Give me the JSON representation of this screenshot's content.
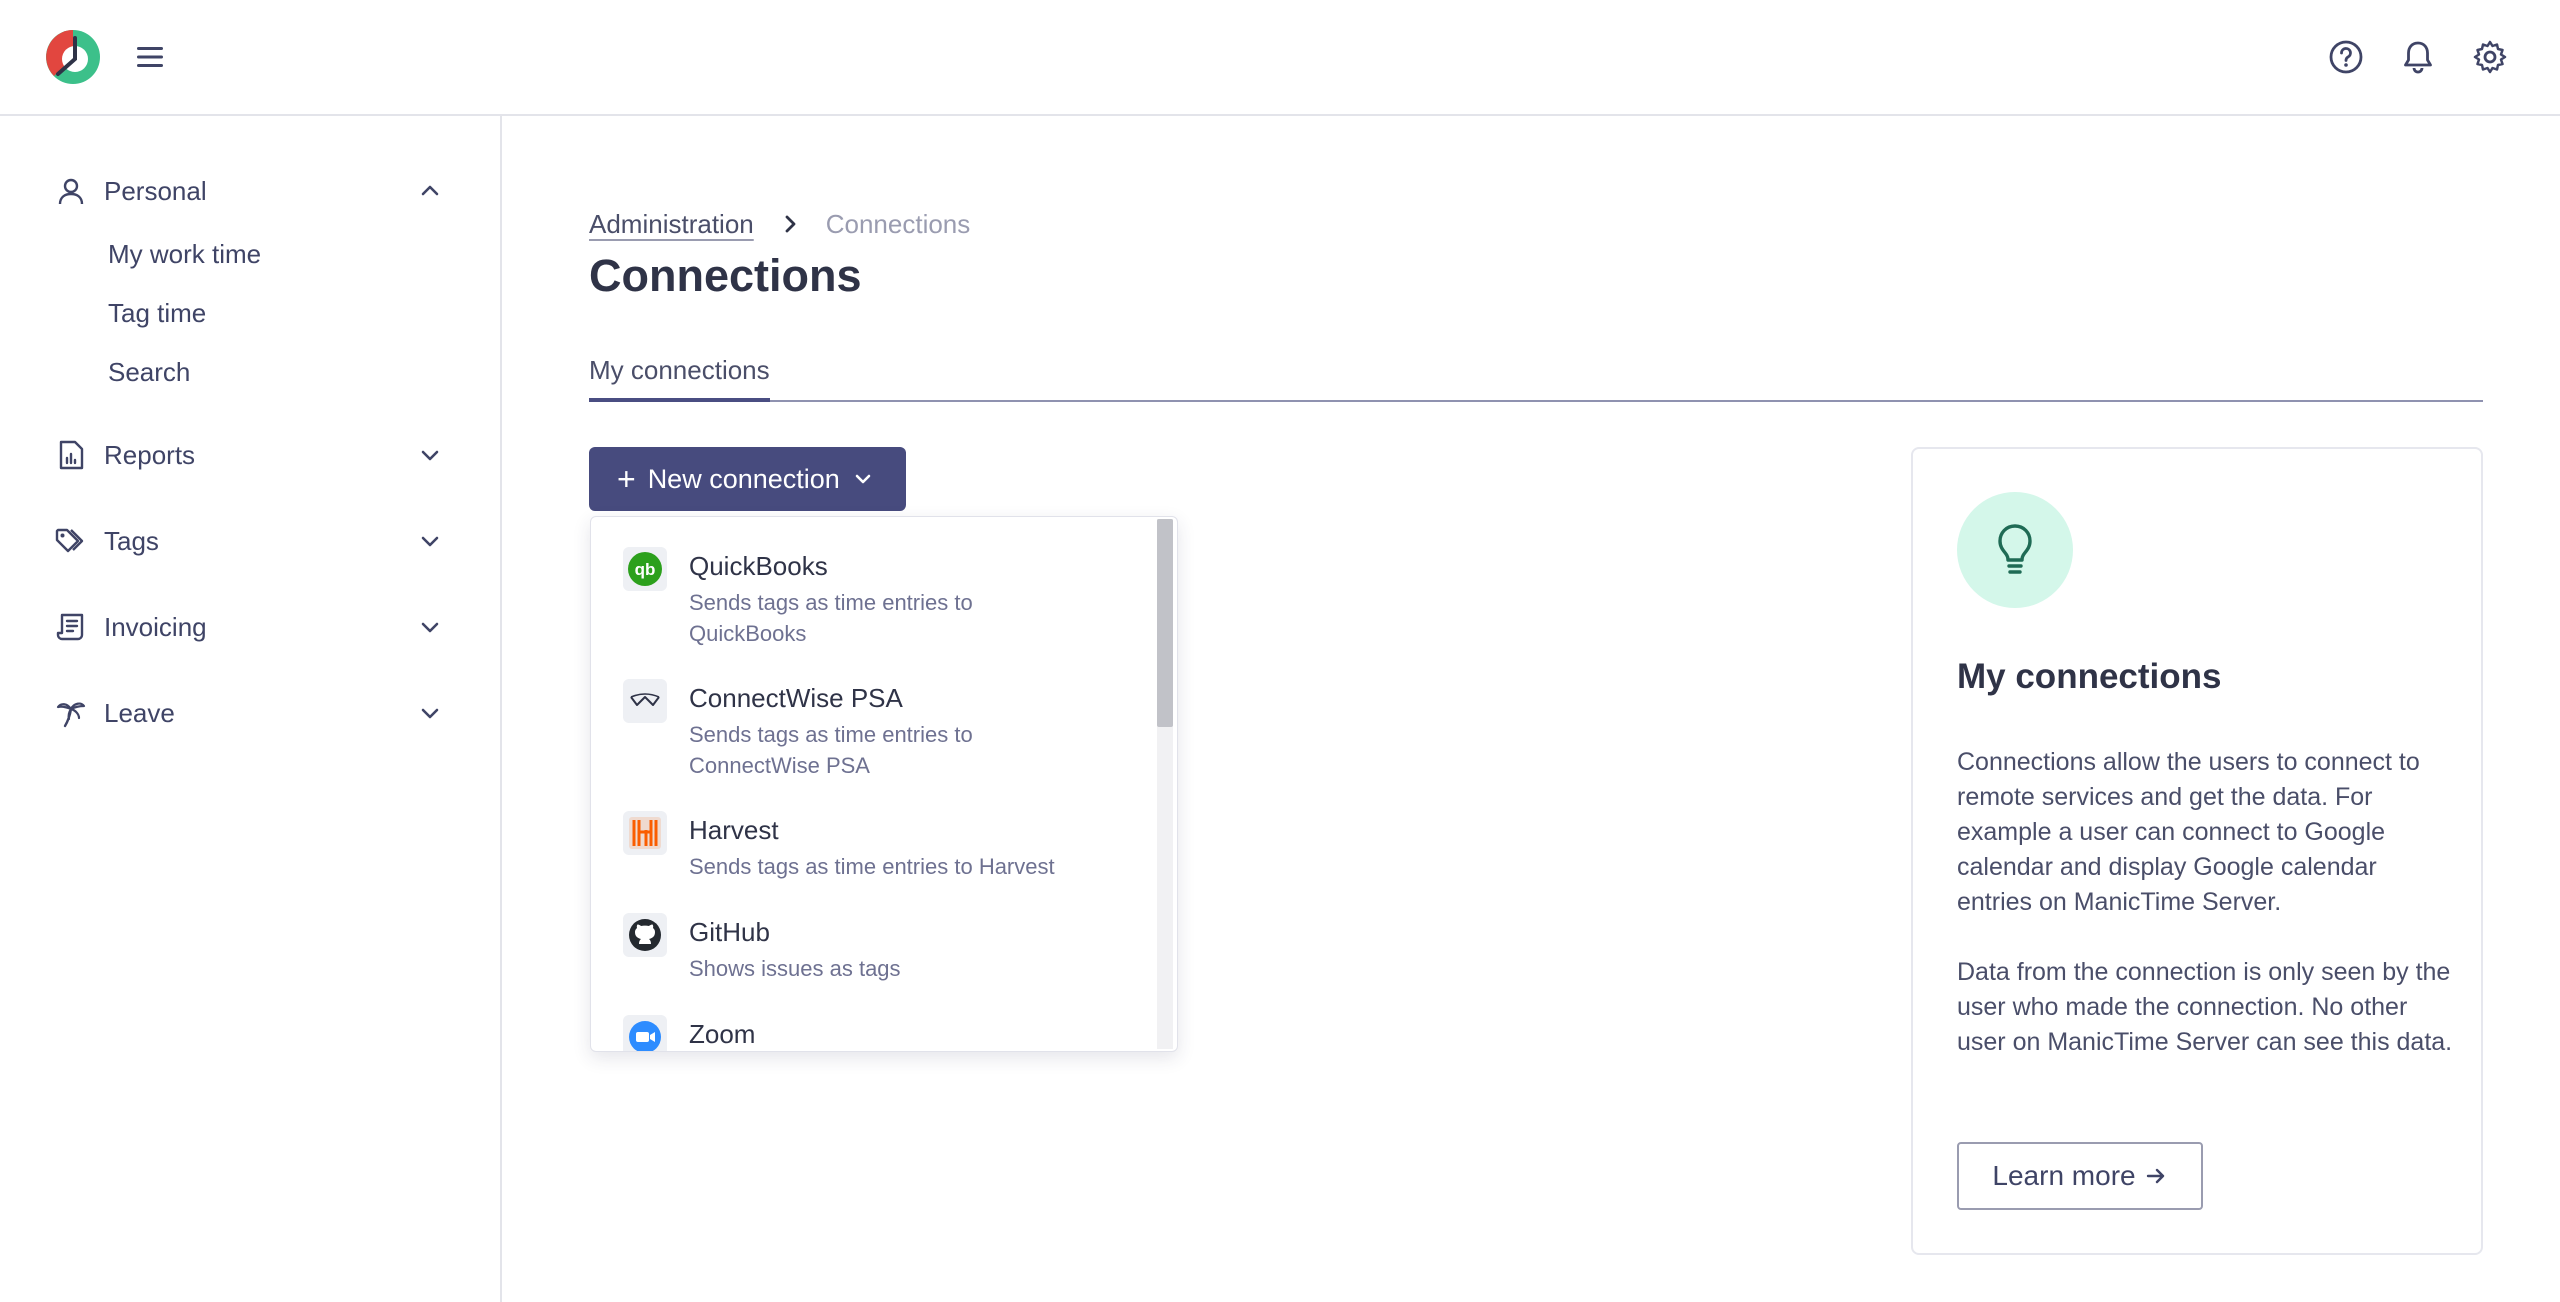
{
  "header": {
    "logo": "manictime-logo",
    "menu_icon": "hamburger-icon",
    "help_icon": "help-circle-icon",
    "notifications_icon": "bell-icon",
    "settings_icon": "gear-icon"
  },
  "sidebar": {
    "personal": {
      "label": "Personal",
      "icon": "user-icon",
      "expanded": true,
      "items": [
        "My work time",
        "Tag time",
        "Search"
      ]
    },
    "groups": [
      {
        "label": "Reports",
        "icon": "report-icon",
        "expanded": false
      },
      {
        "label": "Tags",
        "icon": "tags-icon",
        "expanded": false
      },
      {
        "label": "Invoicing",
        "icon": "invoice-icon",
        "expanded": false
      },
      {
        "label": "Leave",
        "icon": "palm-tree-icon",
        "expanded": false
      }
    ]
  },
  "breadcrumb": {
    "parent": "Administration",
    "current": "Connections"
  },
  "page": {
    "title": "Connections",
    "tab": "My connections"
  },
  "new_connection": {
    "plus": "+",
    "label": "New connection",
    "options": [
      {
        "name": "QuickBooks",
        "description": "Sends tags as time entries to QuickBooks",
        "icon": "quickbooks-icon"
      },
      {
        "name": "ConnectWise PSA",
        "description": "Sends tags as time entries to ConnectWise PSA",
        "icon": "connectwise-icon"
      },
      {
        "name": "Harvest",
        "description": "Sends tags as time entries to Harvest",
        "icon": "harvest-icon"
      },
      {
        "name": "GitHub",
        "description": "Shows issues as tags",
        "icon": "github-icon"
      },
      {
        "name": "Zoom",
        "description": "",
        "icon": "zoom-icon"
      }
    ]
  },
  "info_card": {
    "icon": "lightbulb-icon",
    "title": "My connections",
    "paragraph1": "Connections allow the users to connect to remote services and get the data. For example a user can connect to Google calendar and display Google calendar entries on ManicTime Server.",
    "paragraph2": "Data from the connection is only seen by the user who made the connection. No other user on ManicTime Server can see this data.",
    "learn_more": "Learn more"
  },
  "colors": {
    "accent": "#474b7e",
    "brand_red": "#e2463f",
    "brand_green": "#3cc08a",
    "bulb_bg": "#d4f7ea"
  }
}
